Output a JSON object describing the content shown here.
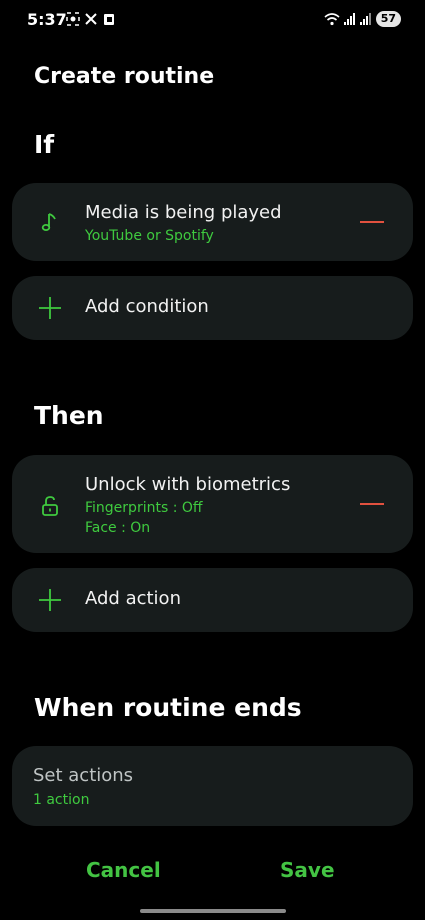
{
  "status_bar": {
    "time": "5:37",
    "battery": "57",
    "left_icons": [
      "screenshot-icon",
      "x-app-icon",
      "clipboard-icon"
    ],
    "right_icons": [
      "wifi-icon",
      "signal-icon",
      "signal-icon"
    ]
  },
  "header": {
    "title": "Create routine"
  },
  "if_section": {
    "title": "If",
    "condition": {
      "icon": "music-note-icon",
      "title": "Media is being played",
      "subtitle": "YouTube or Spotify"
    },
    "add_label": "Add condition"
  },
  "then_section": {
    "title": "Then",
    "action": {
      "icon": "unlock-icon",
      "title": "Unlock with biometrics",
      "detail_1": "Fingerprints : Off",
      "detail_2": "Face : On"
    },
    "add_label": "Add action"
  },
  "ends_section": {
    "title": "When routine ends",
    "set_actions_title": "Set actions",
    "set_actions_subtitle": "1 action"
  },
  "footer": {
    "cancel_label": "Cancel",
    "save_label": "Save"
  },
  "colors": {
    "accent_green": "#3fca3f",
    "remove_red": "#e2513f",
    "card_bg": "#171c1c"
  }
}
